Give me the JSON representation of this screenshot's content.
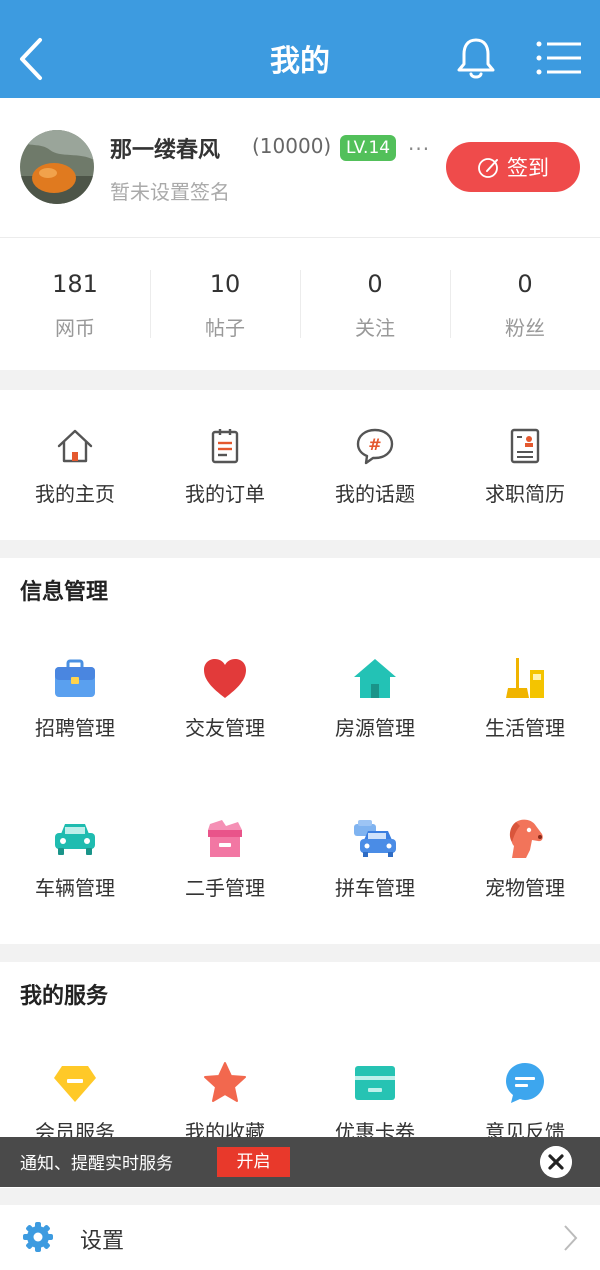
{
  "header": {
    "title": "我的",
    "back_icon": "chevron-left-icon",
    "bell_icon": "bell-icon",
    "menu_icon": "menu-icon"
  },
  "profile": {
    "name": "那一缕春风",
    "uid": "(10000)",
    "level": "LV.14",
    "more": "...",
    "signature": "暂未设置签名",
    "checkin_label": "签到"
  },
  "stats": [
    {
      "value": "181",
      "label": "网币"
    },
    {
      "value": "10",
      "label": "帖子"
    },
    {
      "value": "0",
      "label": "关注"
    },
    {
      "value": "0",
      "label": "粉丝"
    }
  ],
  "quick_links": [
    {
      "label": "我的主页",
      "icon": "home-outline-icon"
    },
    {
      "label": "我的订单",
      "icon": "order-clipboard-icon"
    },
    {
      "label": "我的话题",
      "icon": "topic-hash-icon"
    },
    {
      "label": "求职简历",
      "icon": "resume-icon"
    }
  ],
  "info_management": {
    "title": "信息管理",
    "items": [
      {
        "label": "招聘管理",
        "icon": "briefcase-icon"
      },
      {
        "label": "交友管理",
        "icon": "heart-icon"
      },
      {
        "label": "房源管理",
        "icon": "house-icon"
      },
      {
        "label": "生活管理",
        "icon": "broom-icon"
      },
      {
        "label": "车辆管理",
        "icon": "car-icon"
      },
      {
        "label": "二手管理",
        "icon": "box-icon"
      },
      {
        "label": "拼车管理",
        "icon": "carpool-icon"
      },
      {
        "label": "宠物管理",
        "icon": "dog-icon"
      }
    ]
  },
  "my_services": {
    "title": "我的服务",
    "items": [
      {
        "label": "会员服务",
        "icon": "member-diamond-icon"
      },
      {
        "label": "我的收藏",
        "icon": "star-icon"
      },
      {
        "label": "优惠卡券",
        "icon": "coupon-icon"
      },
      {
        "label": "意见反馈",
        "icon": "feedback-chat-icon"
      }
    ]
  },
  "notification": {
    "text": "通知、提醒实时服务",
    "button": "开启",
    "close_icon": "close-icon"
  },
  "settings": {
    "label": "设置",
    "icon": "gear-icon",
    "chevron_icon": "chevron-right-icon"
  },
  "colors": {
    "header": "#3d9be0",
    "checkin": "#ef4b4b",
    "level_badge": "#52c05a",
    "notif_button": "#e8392b",
    "accent_orange": "#e4582e"
  }
}
